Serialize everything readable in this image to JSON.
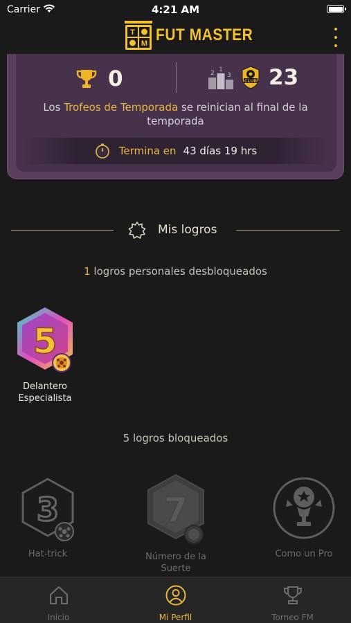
{
  "status_bar": {
    "carrier": "Carrier",
    "time": "4:21 AM"
  },
  "header": {
    "app_name": "FUT MASTER",
    "logo_letters": [
      "T",
      "M"
    ]
  },
  "season": {
    "trophies": "0",
    "rank_podium": [
      "2",
      "1",
      "3"
    ],
    "club_badge": "CLUB",
    "club_position": "23",
    "message_before": "Los ",
    "message_highlight": "Trofeos de Temporada",
    "message_after": " se reinician al final de la temporada",
    "timer_label": "Termina en",
    "timer_value": "43 días 19 hrs"
  },
  "achievements": {
    "title": "Mis logros",
    "unlocked_count": "1",
    "unlocked_text": " logros personales desbloqueados",
    "unlocked": [
      {
        "name": "Delantero Especialista",
        "number": "5"
      }
    ],
    "locked_text": "5 logros bloqueados",
    "locked": [
      {
        "name": "Hat-trick",
        "number": "3"
      },
      {
        "name": "Número de la Suerte",
        "number": "7"
      },
      {
        "name": "Como un Pro"
      }
    ]
  },
  "tabs": [
    {
      "label": "Inicio",
      "icon": "home-icon",
      "active": false
    },
    {
      "label": "Mi Perfil",
      "icon": "profile-icon",
      "active": true
    },
    {
      "label": "Torneo FM",
      "icon": "trophy-icon",
      "active": false
    }
  ],
  "colors": {
    "accent": "#e7b742",
    "background": "#1a1a1a",
    "card": "#46324b",
    "inactive": "#6e6e6e"
  }
}
